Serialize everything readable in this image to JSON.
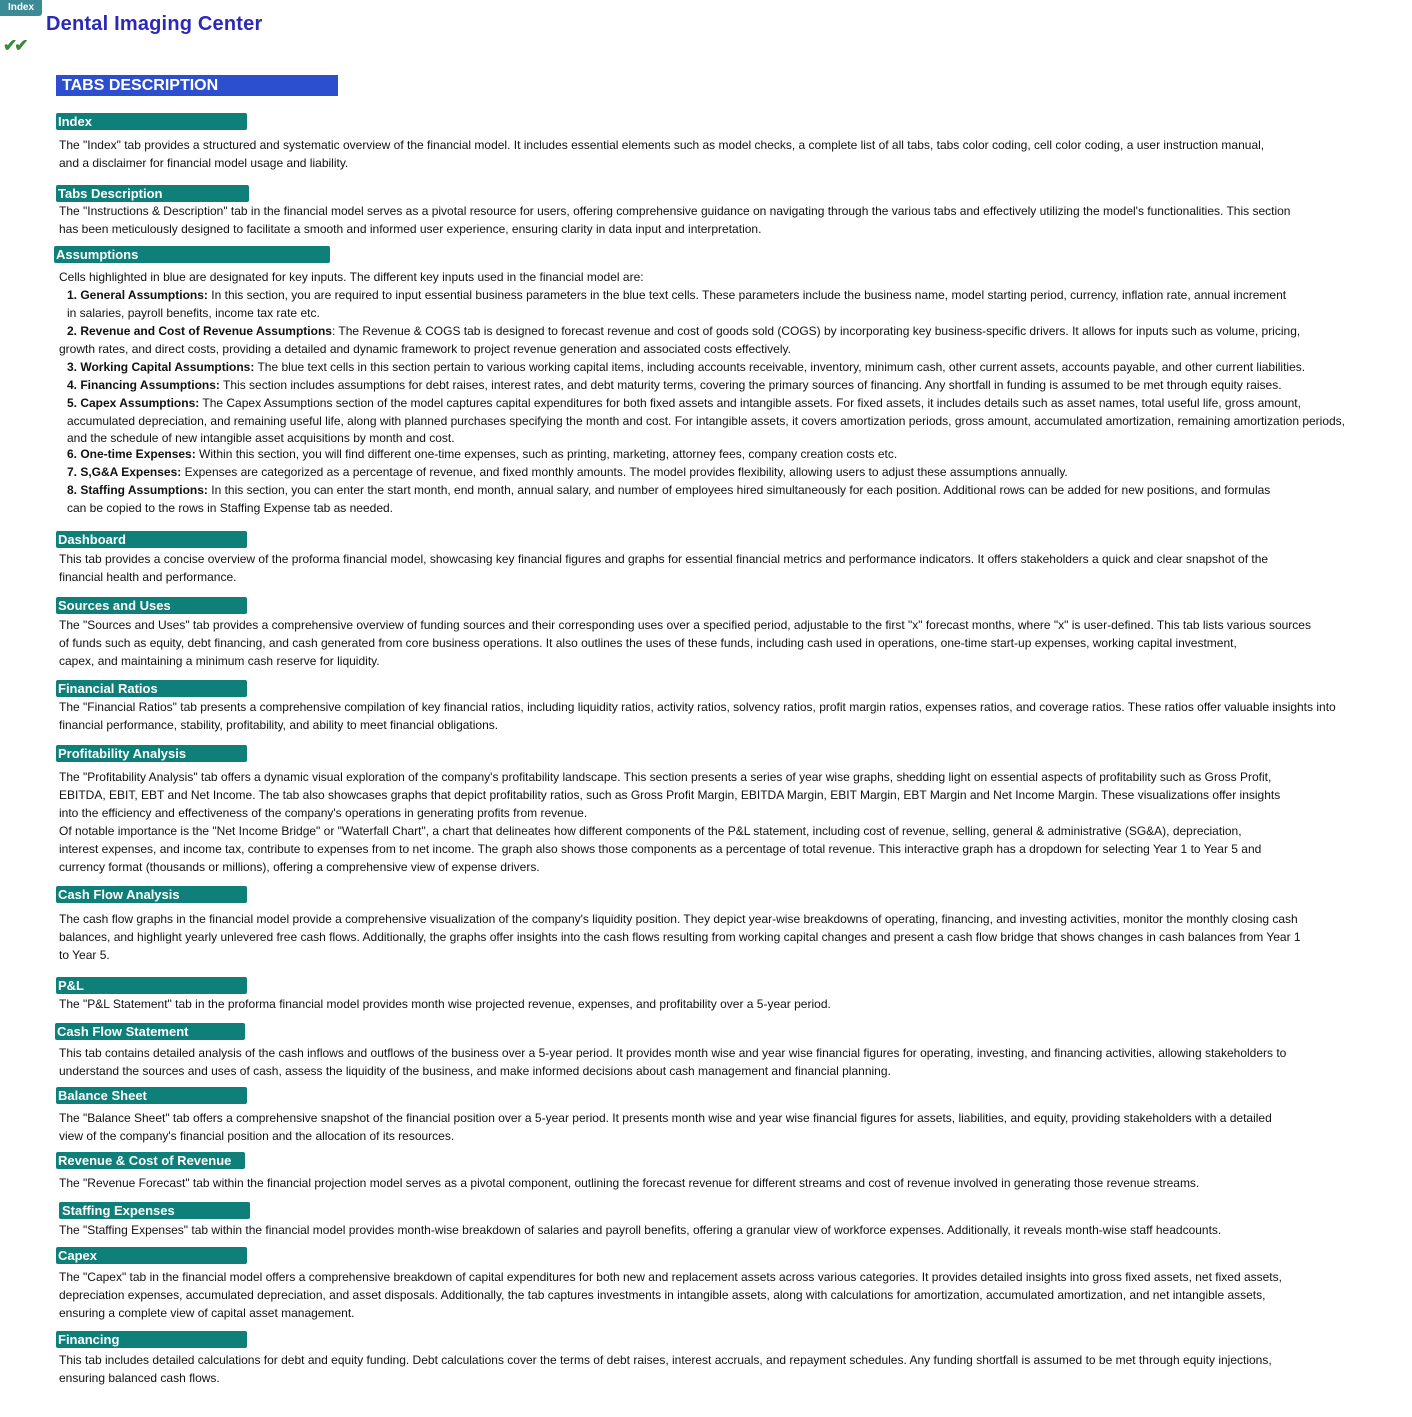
{
  "nav": {
    "index_button": "Index"
  },
  "header": {
    "title": "Dental Imaging Center",
    "check_icon": "double-check-icon",
    "check_glyph": "✔✔",
    "banner": "TABS DESCRIPTION"
  },
  "colors": {
    "title": "#2a2ab8",
    "banner": "#2b4fcf",
    "section_header": "#0f7f7a",
    "index_button": "#3b8a96",
    "check": "#3a8a3a"
  },
  "sections": {
    "index": {
      "heading": "Index",
      "lines": [
        "The \"Index\" tab provides a structured and systematic overview of the financial model. It includes essential elements such as model checks, a complete list of all tabs, tabs color coding, cell color coding, a user instruction manual,",
        "and a disclaimer for financial model usage and liability."
      ]
    },
    "tabs_description": {
      "heading": "Tabs Description",
      "lines": [
        "The \"Instructions & Description\" tab in the financial model serves as a pivotal resource for users, offering comprehensive guidance on navigating through the various tabs and effectively utilizing the model's functionalities. This section",
        "has been meticulously designed to facilitate a smooth and informed user experience, ensuring clarity in data input and interpretation."
      ]
    },
    "assumptions": {
      "heading": "Assumptions",
      "intro": "Cells highlighted in blue are designated for key inputs. The different key inputs used in the financial model are:",
      "items": [
        {
          "label": "1. General Assumptions:",
          "text": " In this section, you are required to input essential business parameters in the blue text cells. These parameters include the business name, model starting period, currency, inflation rate, annual increment",
          "cont": [
            "in salaries, payroll benefits, income tax rate etc."
          ]
        },
        {
          "label": "2. Revenue and Cost of Revenue Assumptions",
          "text": ": The Revenue & COGS tab is designed to forecast revenue and cost of goods sold (COGS) by incorporating key business-specific drivers. It allows for inputs such as volume, pricing,",
          "cont": [
            "growth rates, and direct costs, providing a detailed and dynamic framework to project revenue generation and associated costs effectively."
          ]
        },
        {
          "label": "3. Working Capital Assumptions:",
          "text": " The blue text cells in this section pertain to various working capital items, including accounts receivable, inventory, minimum cash, other current assets, accounts payable,  and other current liabilities.",
          "cont": []
        },
        {
          "label": "4. Financing Assumptions:",
          "text": " This section includes assumptions for debt raises, interest rates, and debt maturity terms, covering the primary sources of financing. Any shortfall in funding is assumed to be met through equity raises.",
          "cont": []
        },
        {
          "label": "5. Capex Assumptions:",
          "text": " The Capex Assumptions section of the model captures capital expenditures for both fixed assets and intangible assets. For fixed assets, it includes details such as asset names, total useful life, gross amount,",
          "cont": [
            "accumulated depreciation, and remaining useful life, along with planned purchases specifying the month and cost. For intangible assets, it covers amortization periods, gross amount, accumulated amortization, remaining amortization periods,",
            "and the schedule of new intangible asset acquisitions by month and cost."
          ]
        },
        {
          "label": "6. One-time Expenses:",
          "text": " Within this section, you will find different one-time expenses, such as printing, marketing, attorney fees, company creation costs etc.",
          "cont": []
        },
        {
          "label": "7. S,G&A Expenses:",
          "text": "  Expenses are categorized as a percentage  of revenue, and fixed monthly amounts. The model provides flexibility, allowing users to adjust these assumptions annually.",
          "cont": []
        },
        {
          "label": "8. Staffing Assumptions:",
          "text": " In this section, you can enter the start month, end month, annual salary, and number of employees hired simultaneously for each position. Additional rows can be added for new positions, and formulas",
          "cont": [
            "can be copied to the rows in Staffing Expense tab as needed."
          ]
        }
      ]
    },
    "dashboard": {
      "heading": "Dashboard",
      "lines": [
        "This tab provides a concise overview of the proforma financial model, showcasing key financial figures and graphs for essential financial metrics and performance indicators. It offers stakeholders a quick and clear snapshot of the",
        "financial health and performance."
      ]
    },
    "sources_uses": {
      "heading": "Sources and Uses",
      "lines": [
        "The \"Sources and Uses\" tab provides a comprehensive overview of funding sources and their corresponding uses over a specified period, adjustable to the first \"x\" forecast months, where \"x\" is user-defined. This tab lists various sources",
        "of funds such as equity, debt financing, and cash generated from core business operations. It also outlines the uses of these funds, including cash used in operations, one-time start-up expenses, working capital investment,",
        "capex, and maintaining  a minimum cash reserve for liquidity."
      ]
    },
    "financial_ratios": {
      "heading": "Financial Ratios",
      "lines": [
        "The \"Financial Ratios\" tab presents a comprehensive compilation of key financial ratios, including liquidity ratios, activity ratios, solvency ratios, profit margin ratios, expenses ratios, and coverage ratios. These ratios offer valuable insights into",
        "financial performance, stability, profitability, and ability to meet financial obligations."
      ]
    },
    "profitability": {
      "heading": "Profitability Analysis",
      "lines": [
        "The \"Profitability Analysis\" tab offers a dynamic visual exploration of the company's profitability landscape. This section presents a series of year wise graphs, shedding light on essential aspects of profitability such as Gross Profit,",
        "EBITDA, EBIT, EBT and Net Income. The tab also showcases graphs that depict profitability ratios, such as Gross Profit Margin, EBITDA Margin, EBIT Margin, EBT Margin and Net Income Margin. These visualizations offer insights",
        "into the efficiency and effectiveness of the company's operations in generating profits from revenue.",
        "Of notable importance is the \"Net Income Bridge\" or \"Waterfall Chart\", a chart that delineates how different components of the P&L statement, including cost of revenue, selling, general & administrative (SG&A), depreciation,",
        "interest expenses, and income tax, contribute to expenses from to net income. The graph also shows those components as a percentage of total revenue. This interactive graph has a dropdown for selecting Year 1 to Year 5 and",
        "currency format (thousands or millions), offering a comprehensive view of expense drivers."
      ]
    },
    "cash_flow_analysis": {
      "heading": "Cash Flow Analysis",
      "lines": [
        "The cash flow graphs in the financial model provide a comprehensive visualization of the company's liquidity position. They depict year-wise breakdowns of operating, financing, and investing activities, monitor the monthly closing cash",
        "balances, and highlight yearly unlevered free cash flows. Additionally, the graphs offer insights into the cash flows resulting from working capital changes and present a cash flow bridge that shows changes in cash balances from Year 1",
        "to Year 5."
      ]
    },
    "pnl": {
      "heading": "P&L",
      "lines": [
        "The \"P&L Statement\" tab in the proforma financial model provides month wise projected revenue, expenses, and profitability over a 5-year period."
      ]
    },
    "cash_flow_statement": {
      "heading": "Cash Flow Statement",
      "lines": [
        "This tab contains detailed analysis of the cash inflows and outflows of the business over a 5-year period. It provides month wise and year wise financial figures for operating, investing, and financing activities, allowing stakeholders to",
        "understand the sources and uses of cash, assess the liquidity of the business, and make informed decisions about cash management and financial planning."
      ]
    },
    "balance_sheet": {
      "heading": "Balance Sheet",
      "lines": [
        "The \"Balance Sheet\" tab offers a comprehensive snapshot of the financial position over a 5-year period. It presents month wise and year wise financial figures for assets, liabilities, and equity, providing stakeholders with a detailed",
        "view of the company's financial position and the allocation of its resources."
      ]
    },
    "revenue_cost": {
      "heading": "Revenue & Cost of Revenue",
      "lines": [
        "The \"Revenue Forecast\" tab within the financial projection model serves as a pivotal component, outlining the forecast revenue for different streams and cost of revenue involved in generating those revenue streams."
      ]
    },
    "staffing": {
      "heading": "Staffing Expenses",
      "lines": [
        "The \"Staffing Expenses\" tab within the financial model provides month-wise breakdown of salaries and payroll benefits, offering  a granular view of workforce expenses. Additionally, it reveals month-wise staff headcounts."
      ]
    },
    "capex": {
      "heading": "Capex",
      "lines": [
        "The \"Capex\" tab in the financial model offers a comprehensive breakdown of capital expenditures for both new and replacement assets across various categories. It provides detailed insights into gross fixed assets, net fixed assets,",
        "depreciation expenses, accumulated depreciation, and asset disposals. Additionally, the tab captures investments in intangible assets, along with calculations for amortization, accumulated amortization, and net intangible assets,",
        "ensuring a complete view of capital asset management."
      ]
    },
    "financing": {
      "heading": "Financing",
      "lines": [
        "This tab includes detailed calculations for debt and equity funding. Debt calculations cover the terms of debt raises, interest accruals, and repayment schedules. Any funding shortfall is assumed to be met through equity injections,",
        "ensuring balanced cash flows."
      ]
    }
  }
}
